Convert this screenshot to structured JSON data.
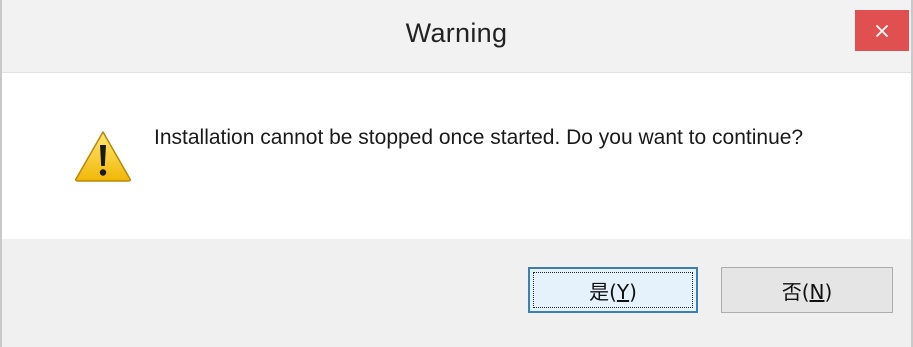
{
  "window": {
    "title": "Warning",
    "close_icon": "close-icon"
  },
  "dialog": {
    "icon": "warning-triangle-icon",
    "message": "Installation cannot be stopped once started. Do you want to continue?"
  },
  "buttons": {
    "yes": {
      "prefix": "是",
      "mnemonic_open": "(",
      "mnemonic": "Y",
      "mnemonic_close": ")"
    },
    "no": {
      "prefix": "否",
      "mnemonic_open": "(",
      "mnemonic": "N",
      "mnemonic_close": ")"
    }
  },
  "colors": {
    "close_button": "#e04343",
    "default_button_border": "#3c7fb1",
    "icon_fill": "#f5c518"
  }
}
